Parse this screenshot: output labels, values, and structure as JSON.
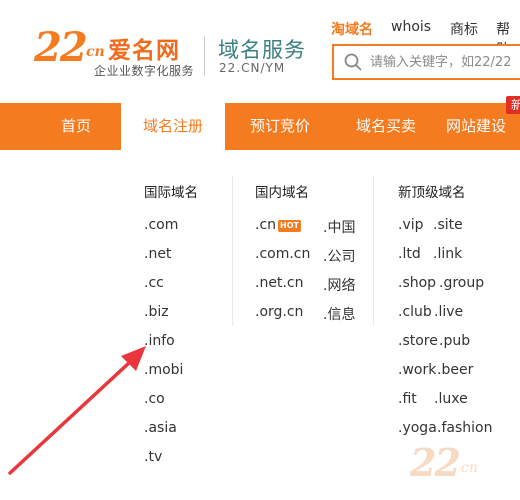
{
  "header": {
    "logo_number": "22",
    "logo_cn": "cn",
    "logo_brand": "爱名网",
    "logo_slogan": "企业业数字化服务",
    "service_title": "域名服务",
    "service_url": "22.CN/YM"
  },
  "top_links": [
    {
      "label": "淘域名",
      "active": true
    },
    {
      "label": "whois",
      "active": false
    },
    {
      "label": "商标",
      "active": false
    },
    {
      "label": "帮助",
      "active": false
    }
  ],
  "search": {
    "placeholder": "请输入关键字，如22/22"
  },
  "nav": {
    "items": [
      {
        "label": "首页"
      },
      {
        "label": "域名注册"
      },
      {
        "label": "预订竞价"
      },
      {
        "label": "域名买卖"
      },
      {
        "label": "网站建设"
      }
    ],
    "badge": "新"
  },
  "dropdown": {
    "international": {
      "heading": "国际域名",
      "items": [
        ".com",
        ".net",
        ".cc",
        ".biz",
        ".info",
        ".mobi",
        ".co",
        ".asia",
        ".tv"
      ]
    },
    "domestic": {
      "heading": "国内域名",
      "items": [
        ".cn",
        ".中国",
        ".com.cn",
        ".公司",
        ".net.cn",
        ".网络",
        ".org.cn",
        ".信息"
      ],
      "hot_badge": "HOT"
    },
    "new_gtld": {
      "heading": "新顶级域名",
      "items": [
        ".vip",
        ".site",
        ".ltd",
        ".link",
        ".shop",
        ".group",
        ".club",
        ".live",
        ".store",
        ".pub",
        ".work",
        ".beer",
        ".fit",
        ".luxe",
        ".yoga",
        ".fashion"
      ]
    }
  },
  "watermark": {
    "number": "22",
    "cn": "cn"
  },
  "colors": {
    "brand_orange": "#f47b20",
    "service_teal": "#3a7f82",
    "badge_red": "#e02e24",
    "annotation_arrow": "#e8363c"
  }
}
